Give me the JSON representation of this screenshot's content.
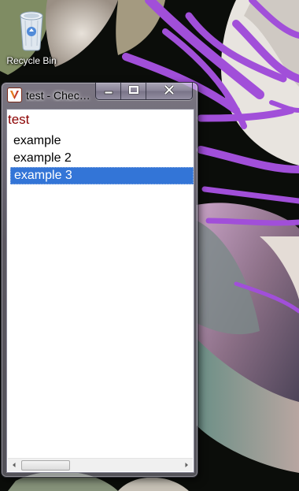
{
  "desktop": {
    "icons": [
      {
        "label": "Recycle Bin",
        "icon": "recycle-bin-icon"
      }
    ]
  },
  "window": {
    "title": "test - Chec…",
    "app_icon": "app-icon",
    "caption_buttons": [
      "minimize-icon",
      "maximize-icon",
      "close-icon"
    ],
    "heading": "test",
    "list": {
      "items": [
        "example",
        "example 2",
        "example 3"
      ],
      "selected_index": 2
    },
    "hscrollbar": {
      "thumb_fraction": 0.31,
      "position_fraction": 0.0
    }
  },
  "colors": {
    "heading": "#8b0000",
    "selection": "#3375d7",
    "selection_text": "#ffffff"
  }
}
